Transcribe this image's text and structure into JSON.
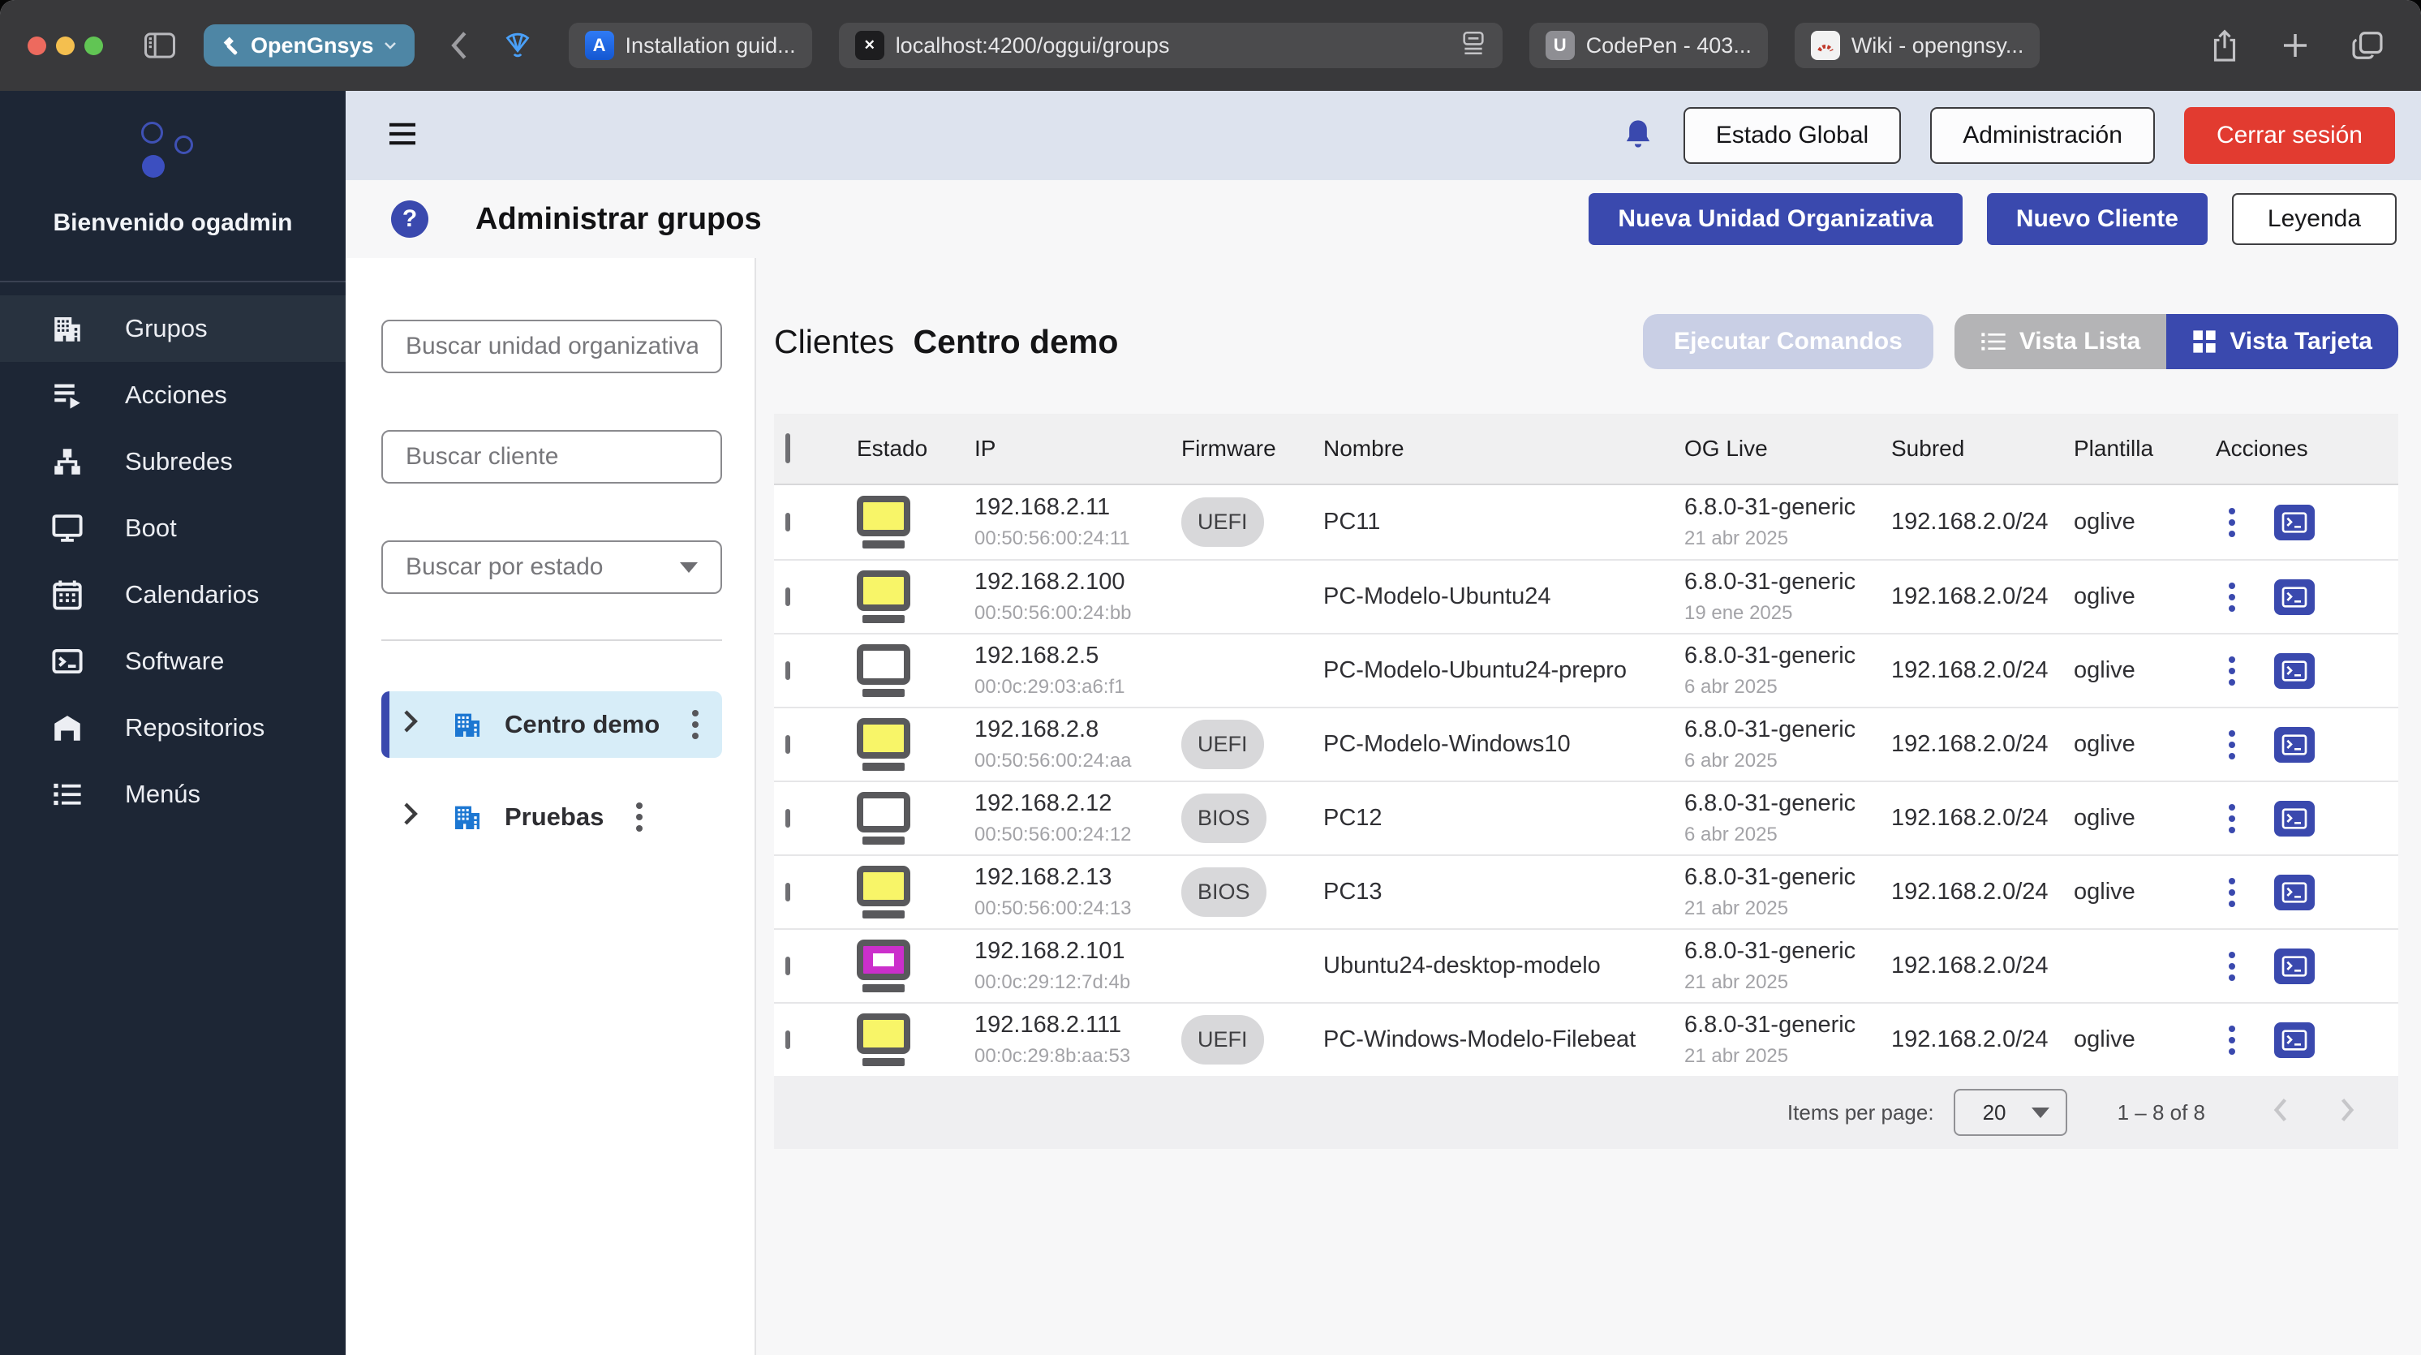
{
  "window": {
    "traffic_lights": [
      "#ed6a5e",
      "#f4bf4f",
      "#61c554"
    ]
  },
  "browser": {
    "profile_label": "OpenGnsys",
    "tabs": [
      {
        "title": "Installation guid...",
        "favicon": "atlassian",
        "active": false
      },
      {
        "title": "localhost:4200/oggui/groups",
        "favicon": "localhost",
        "active": true
      },
      {
        "title": "CodePen - 403...",
        "favicon": "codepen",
        "active": false
      },
      {
        "title": "Wiki - opengnsy...",
        "favicon": "wiki",
        "active": false
      }
    ]
  },
  "sidebar": {
    "welcome": "Bienvenido ogadmin",
    "items": [
      {
        "label": "Grupos",
        "icon": "building",
        "active": true
      },
      {
        "label": "Acciones",
        "icon": "actions",
        "active": false
      },
      {
        "label": "Subredes",
        "icon": "network",
        "active": false
      },
      {
        "label": "Boot",
        "icon": "monitor",
        "active": false
      },
      {
        "label": "Calendarios",
        "icon": "calendar",
        "active": false
      },
      {
        "label": "Software",
        "icon": "terminal",
        "active": false
      },
      {
        "label": "Repositorios",
        "icon": "warehouse",
        "active": false
      },
      {
        "label": "Menús",
        "icon": "list",
        "active": false
      }
    ]
  },
  "toolbar": {
    "estado_global": "Estado Global",
    "administracion": "Administración",
    "cerrar_sesion": "Cerrar sesión"
  },
  "page": {
    "title": "Administrar grupos",
    "new_ou": "Nueva Unidad Organizativa",
    "new_client": "Nuevo Cliente",
    "legend": "Leyenda"
  },
  "filters": {
    "ou_placeholder": "Buscar unidad organizativa",
    "client_placeholder": "Buscar cliente",
    "state_placeholder": "Buscar por estado"
  },
  "tree": [
    {
      "name": "Centro demo",
      "selected": true
    },
    {
      "name": "Pruebas",
      "selected": false
    }
  ],
  "clients": {
    "heading_prefix": "Clientes",
    "heading_name": "Centro demo",
    "execute_commands": "Ejecutar Comandos",
    "view_list": "Vista Lista",
    "view_card": "Vista Tarjeta"
  },
  "table": {
    "columns": [
      "Estado",
      "IP",
      "Firmware",
      "Nombre",
      "OG Live",
      "Subred",
      "Plantilla",
      "Acciones"
    ],
    "rows": [
      {
        "status": "on",
        "ip": "192.168.2.11",
        "mac": "00:50:56:00:24:11",
        "firmware": "UEFI",
        "name": "PC11",
        "oglive": "6.8.0-31-generic",
        "oglive_date": "21 abr 2025",
        "subnet": "192.168.2.0/24",
        "template": "oglive"
      },
      {
        "status": "on",
        "ip": "192.168.2.100",
        "mac": "00:50:56:00:24:bb",
        "firmware": "",
        "name": "PC-Modelo-Ubuntu24",
        "oglive": "6.8.0-31-generic",
        "oglive_date": "19 ene 2025",
        "subnet": "192.168.2.0/24",
        "template": "oglive"
      },
      {
        "status": "off",
        "ip": "192.168.2.5",
        "mac": "00:0c:29:03:a6:f1",
        "firmware": "",
        "name": "PC-Modelo-Ubuntu24-prepro",
        "oglive": "6.8.0-31-generic",
        "oglive_date": "6 abr 2025",
        "subnet": "192.168.2.0/24",
        "template": "oglive"
      },
      {
        "status": "on",
        "ip": "192.168.2.8",
        "mac": "00:50:56:00:24:aa",
        "firmware": "UEFI",
        "name": "PC-Modelo-Windows10",
        "oglive": "6.8.0-31-generic",
        "oglive_date": "6 abr 2025",
        "subnet": "192.168.2.0/24",
        "template": "oglive"
      },
      {
        "status": "off",
        "ip": "192.168.2.12",
        "mac": "00:50:56:00:24:12",
        "firmware": "BIOS",
        "name": "PC12",
        "oglive": "6.8.0-31-generic",
        "oglive_date": "6 abr 2025",
        "subnet": "192.168.2.0/24",
        "template": "oglive"
      },
      {
        "status": "on",
        "ip": "192.168.2.13",
        "mac": "00:50:56:00:24:13",
        "firmware": "BIOS",
        "name": "PC13",
        "oglive": "6.8.0-31-generic",
        "oglive_date": "21 abr 2025",
        "subnet": "192.168.2.0/24",
        "template": "oglive"
      },
      {
        "status": "busy",
        "ip": "192.168.2.101",
        "mac": "00:0c:29:12:7d:4b",
        "firmware": "",
        "name": "Ubuntu24-desktop-modelo",
        "oglive": "6.8.0-31-generic",
        "oglive_date": "21 abr 2025",
        "subnet": "192.168.2.0/24",
        "template": ""
      },
      {
        "status": "on",
        "ip": "192.168.2.111",
        "mac": "00:0c:29:8b:aa:53",
        "firmware": "UEFI",
        "name": "PC-Windows-Modelo-Filebeat",
        "oglive": "6.8.0-31-generic",
        "oglive_date": "21 abr 2025",
        "subnet": "192.168.2.0/24",
        "template": "oglive"
      }
    ]
  },
  "paginator": {
    "label": "Items per page:",
    "page_size": "20",
    "range": "1 – 8 of 8"
  },
  "colors": {
    "accent": "#3a49ae",
    "danger": "#e23b30",
    "profile": "#4e86a5",
    "tree_selected_bg": "#d7edf8",
    "status_on": "#f8f568",
    "status_busy": "#cb2fcb"
  }
}
